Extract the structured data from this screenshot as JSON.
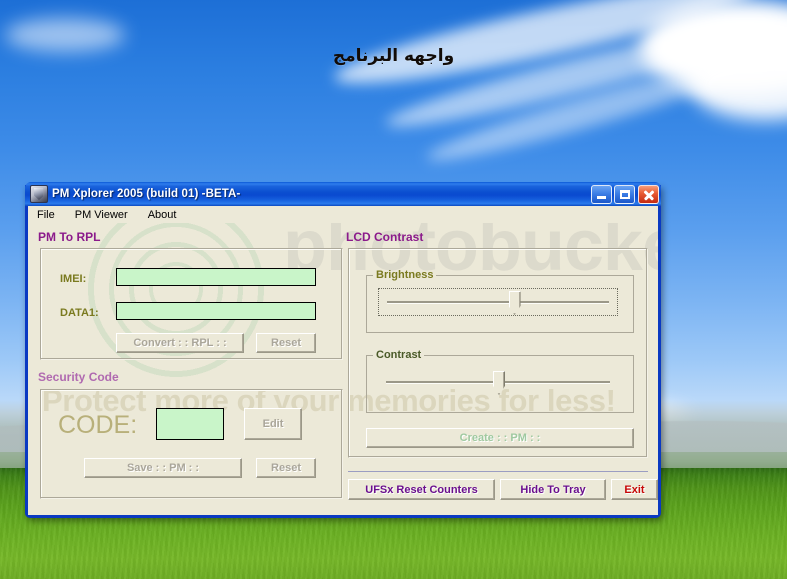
{
  "desktop": {
    "caption": "واجهه البرنامج",
    "wallpaper_name": "bliss-wallpaper"
  },
  "watermark": {
    "brand": "photobucket",
    "tagline": "Protect more of your memories for less!"
  },
  "window": {
    "title": "PM Xplorer 2005 (build 01) -BETA-",
    "icon": "app-icon",
    "caption_buttons": {
      "minimize": "minimize-icon",
      "maximize": "maximize-icon",
      "close": "close-icon"
    },
    "menu": [
      {
        "label": "File"
      },
      {
        "label": "PM Viewer"
      },
      {
        "label": "About"
      }
    ]
  },
  "pm_to_rpl": {
    "title": "PM To RPL",
    "imei_label": "IMEI:",
    "imei_value": "",
    "data1_label": "DATA1:",
    "data1_value": "",
    "convert_button": "Convert : : RPL : :",
    "reset_button": "Reset"
  },
  "security_code": {
    "title": "Security Code",
    "code_label": "CODE:",
    "code_value": "",
    "edit_button": "Edit",
    "save_button": "Save : : PM : :",
    "reset_button": "Reset"
  },
  "lcd_contrast": {
    "title": "LCD Contrast",
    "brightness": {
      "label": "Brightness",
      "value": 57,
      "min": 0,
      "max": 100
    },
    "contrast": {
      "label": "Contrast",
      "value": 50,
      "min": 0,
      "max": 100
    },
    "create_button": "Create : : PM : :"
  },
  "footer": {
    "ufsx_reset_button": "UFSx Reset Counters",
    "hide_tray_button": "Hide To Tray",
    "exit_button": "Exit"
  },
  "colors": {
    "titlebar_blue": "#0b4fd0",
    "face": "#ece9d8",
    "green_field": "#c9f5c9",
    "section_purple": "#8b1a8b",
    "label_olive": "#7a7a1f",
    "purple_button": "#6a0f8e",
    "red_button": "#c70808"
  }
}
